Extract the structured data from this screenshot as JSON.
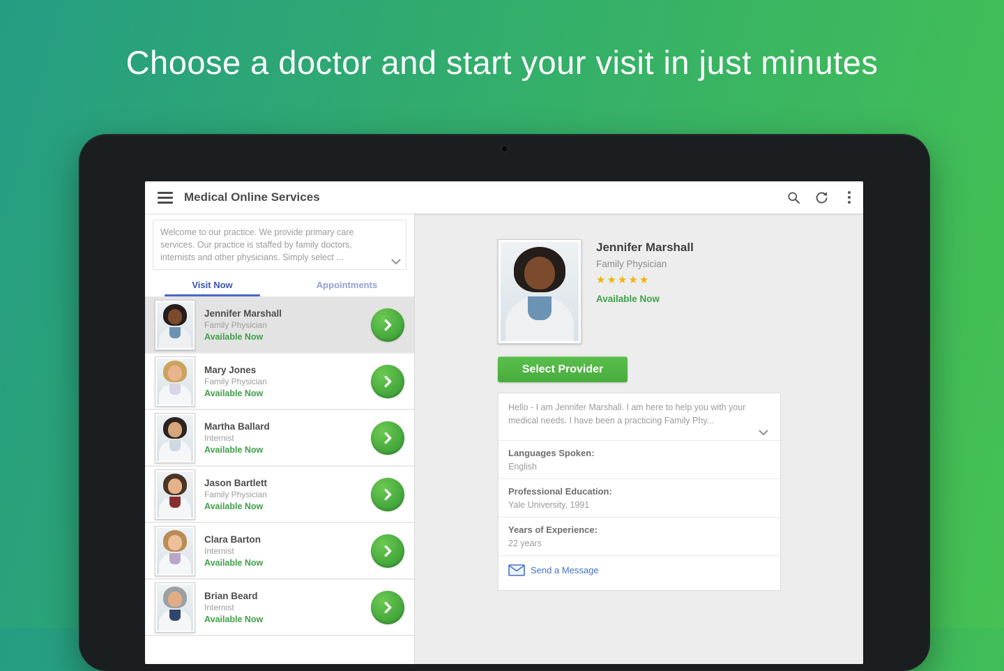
{
  "hero": {
    "headline": "Choose a doctor and start your visit in just minutes"
  },
  "appbar": {
    "title": "Medical Online Services",
    "icons": {
      "menu": "hamburger",
      "search": "magnifier",
      "refresh": "circular-arrows",
      "overflow": "vertical-ellipsis"
    }
  },
  "intro": {
    "text": "Welcome to our practice. We provide primary care services. Our practice is staffed by family doctors, internists and other physicians. Simply select ...",
    "expand_icon": "chevron-down"
  },
  "tabs": [
    {
      "label": "Visit Now",
      "active": true
    },
    {
      "label": "Appointments",
      "active": false
    }
  ],
  "doctors": [
    {
      "name": "Jennifer Marshall",
      "specialty": "Family Physician",
      "status": "Available Now",
      "selected": true,
      "avatar_css": "--skin:#7c4a2d;--hair:#241d19;--coat:#eef0f1;--shirt:#6b93b4"
    },
    {
      "name": "Mary Jones",
      "specialty": "Family Physician",
      "status": "Available Now",
      "selected": false,
      "avatar_css": "--skin:#e8b48e;--hair:#caa45c;--coat:#f4f6f7;--shirt:#d9d4e8"
    },
    {
      "name": "Martha Ballard",
      "specialty": "Internist",
      "status": "Available Now",
      "selected": false,
      "avatar_css": "--skin:#d8a57c;--hair:#2b241f;--coat:#f4f6f7;--shirt:#cfd8de"
    },
    {
      "name": "Jason Bartlett",
      "specialty": "Family Physician",
      "status": "Available Now",
      "selected": false,
      "avatar_css": "--skin:#e6b28a;--hair:#4a3525;--coat:#f4f6f7;--shirt:#8a2f2f"
    },
    {
      "name": "Clara Barton",
      "specialty": "Internist",
      "status": "Available Now",
      "selected": false,
      "avatar_css": "--skin:#eec09a;--hair:#b98c55;--coat:#f4f6f7;--shirt:#b9a6c9"
    },
    {
      "name": "Brian Beard",
      "specialty": "Internist",
      "status": "Available Now",
      "selected": false,
      "avatar_css": "--skin:#e2ad85;--hair:#9aa0a3;--coat:#f4f6f7;--shirt:#32456e"
    }
  ],
  "detail": {
    "name": "Jennifer Marshall",
    "specialty": "Family Physician",
    "rating": 5,
    "status": "Available Now",
    "select_button": "Select Provider",
    "bio": "Hello - I am Jennifer Marshall. I am here to help you with your medical needs. I have been a practicing Family Phy...",
    "fields": [
      {
        "label": "Languages Spoken:",
        "value": "English"
      },
      {
        "label": "Professional Education:",
        "value": "Yale University, 1991"
      },
      {
        "label": "Years of Experience:",
        "value": "22 years"
      }
    ],
    "message_link": "Send a Message",
    "message_icon": "envelope"
  },
  "colors": {
    "accent_green": "#4bb543",
    "status_green": "#3fa148",
    "link_blue": "#4273c9",
    "tab_active_blue": "#3a53b4",
    "star_gold": "#f0b400",
    "gradient_start": "#259d83",
    "gradient_end": "#46c152"
  }
}
